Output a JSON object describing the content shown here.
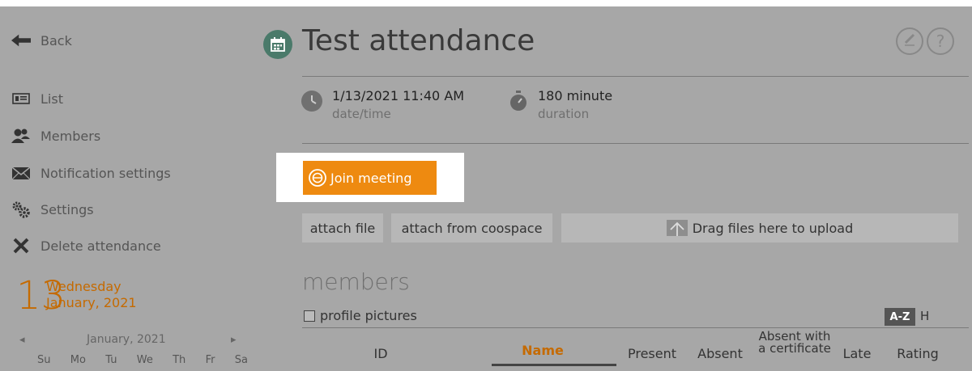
{
  "sidebar": {
    "back_label": "Back",
    "items": [
      {
        "label": "List",
        "icon": "list-card-icon"
      },
      {
        "label": "Members",
        "icon": "members-icon"
      },
      {
        "label": "Notification settings",
        "icon": "envelope-icon"
      },
      {
        "label": "Settings",
        "icon": "gears-icon"
      },
      {
        "label": "Delete attendance",
        "icon": "x-icon"
      }
    ],
    "date": {
      "day": "13",
      "weekday": "Wednesday",
      "month_year": "January, 2021"
    },
    "mini_calendar": {
      "month_label": "January, 2021",
      "weekdays": [
        "Su",
        "Mo",
        "Tu",
        "We",
        "Th",
        "Fr",
        "Sa"
      ]
    }
  },
  "header": {
    "title": "Test attendance"
  },
  "meta": {
    "datetime_value": "1/13/2021 11:40 AM",
    "datetime_label": "date/time",
    "duration_value": "180 minute",
    "duration_label": "duration"
  },
  "actions": {
    "join_label": "Join meeting",
    "attach_file_label": "attach file",
    "attach_coospace_label": "attach from coospace",
    "drop_label": "Drag files here to upload"
  },
  "members": {
    "heading": "members",
    "profile_pictures_label": "profile pictures",
    "sort_az": "A-Z",
    "sort_h": "H",
    "columns": [
      "ID",
      "Name",
      "Present",
      "Absent",
      "Absent with a certificate",
      "Late",
      "Rating"
    ]
  },
  "colors": {
    "accent": "#ee8a10",
    "date_orange": "#c56a00",
    "background": "#a7a7a7"
  }
}
